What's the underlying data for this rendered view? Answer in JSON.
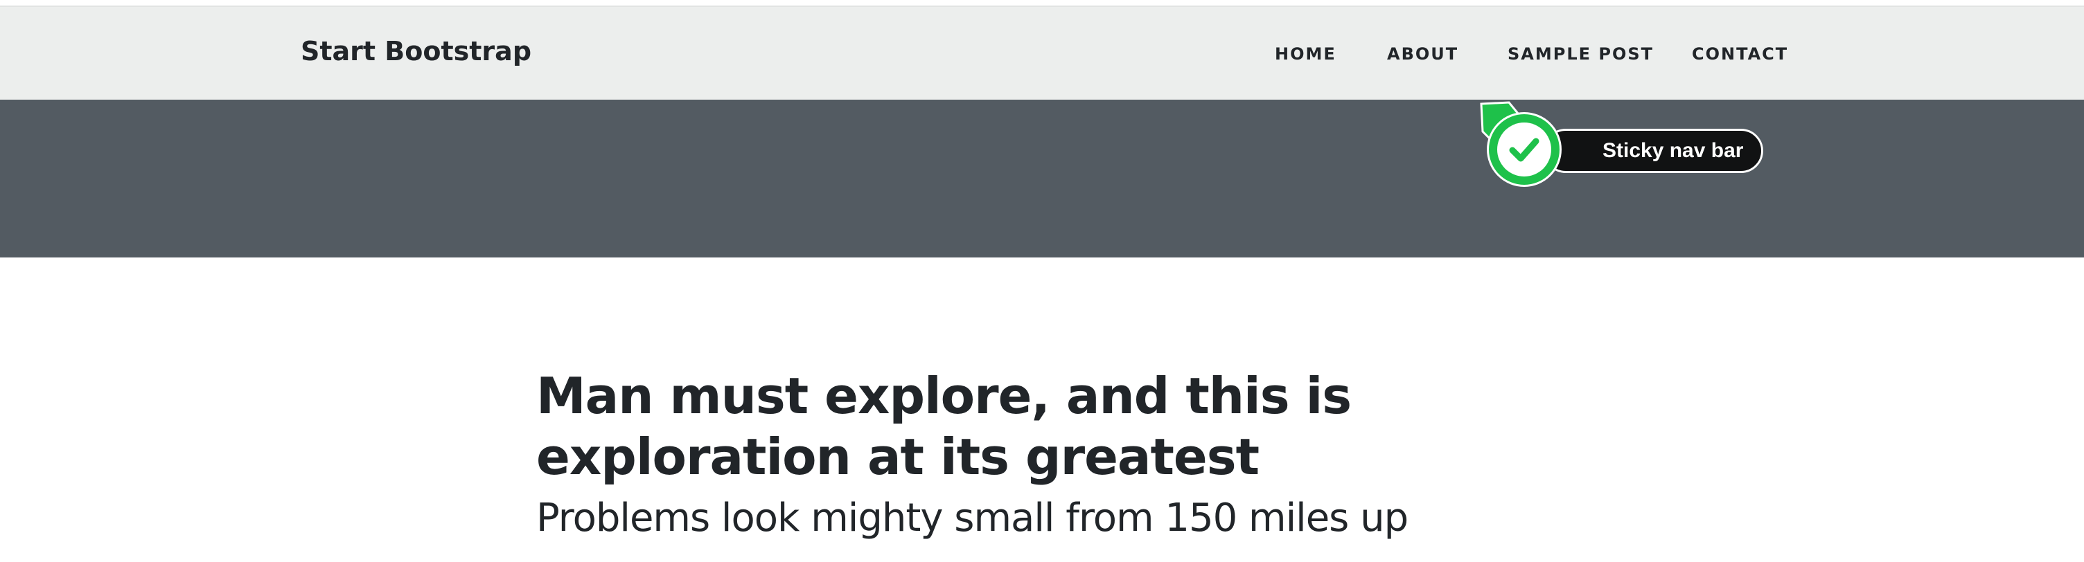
{
  "navbar": {
    "brand": "Start Bootstrap",
    "links": [
      {
        "label": "HOME"
      },
      {
        "label": "ABOUT"
      },
      {
        "label": "SAMPLE POST"
      },
      {
        "label": "CONTACT"
      }
    ]
  },
  "annotation": {
    "label": "Sticky nav bar",
    "icon": "check-icon",
    "badge_color": "#1ec14a"
  },
  "post": {
    "title": "Man must explore, and this is exploration at its greatest",
    "subtitle": "Problems look mighty small from 150 miles up"
  },
  "colors": {
    "navbar_bg": "#eceeed",
    "hero_bg": "#535b62",
    "text": "#212529"
  }
}
